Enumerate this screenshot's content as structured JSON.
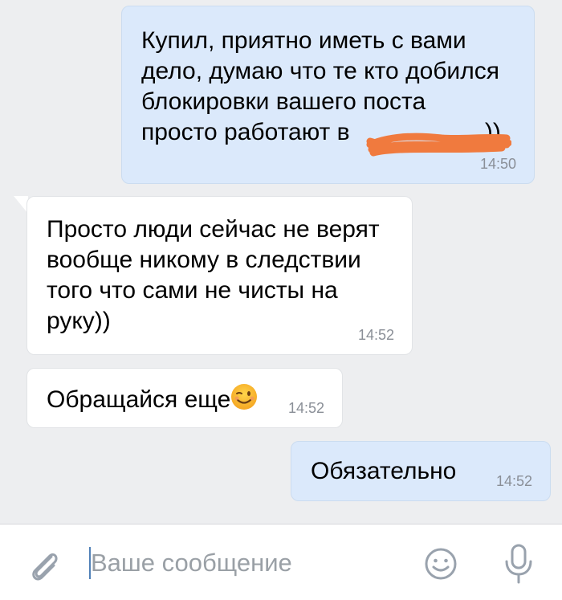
{
  "messages": [
    {
      "direction": "outgoing",
      "text_visible": "Купил, приятно иметь с вами\nдело, думаю что те кто добился\nблокировки вашего поста\nпросто работают в",
      "text_end": "))",
      "time": "14:50"
    },
    {
      "direction": "incoming",
      "text": "Просто люди сейчас не верят\nвообще никому в следствии\nтого что сами не чисты на\nруку))",
      "time": "14:52"
    },
    {
      "direction": "incoming",
      "text": "Обращайся еще",
      "time": "14:52"
    },
    {
      "direction": "outgoing",
      "text": "Обязательно",
      "time": "14:52"
    }
  ],
  "input": {
    "placeholder": "Ваше сообщение",
    "value": ""
  },
  "icons": {
    "attach": "paperclip-icon",
    "emoji_in_message": "winking-face-icon",
    "emoji_button": "smiley-icon",
    "mic": "microphone-icon",
    "redaction": "scribble-redaction"
  },
  "colors": {
    "background": "#edeef0",
    "outgoing_bubble": "#dbe9fb",
    "incoming_bubble": "#ffffff",
    "time_text": "#8a8f97",
    "redaction_scribble": "#f07a3e",
    "icon_gray": "#99a2ad",
    "cursor": "#5181b8"
  }
}
